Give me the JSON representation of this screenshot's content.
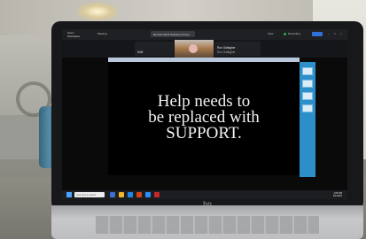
{
  "photo": {
    "setting": "room",
    "device": "laptop"
  },
  "laptop": {
    "brand_logo": "hp"
  },
  "zoom": {
    "app_title_line1": "Zoom",
    "app_title_line2": "Workplace",
    "top_item": "Meeting",
    "tab_label": "Remote Work Solutions Group",
    "view_label": "View",
    "participant_1": "Holli",
    "participant_2": "Ron Gallagher",
    "participant_2_sub": "Ron Gallagher",
    "recording_label": "Recording",
    "leave_label": "Leave"
  },
  "slide": {
    "line1": "Help needs to",
    "line2": "be replaced with",
    "line3": "SUPPORT."
  },
  "taskbar": {
    "search_placeholder": "Type here to search",
    "time": "1:05 PM",
    "date": "6/1/2022"
  },
  "icons": [
    "windows-icon",
    "search-icon",
    "video-icon",
    "mic-icon",
    "share-icon",
    "chat-icon",
    "participants-icon"
  ],
  "colors": {
    "slide_bg": "#000000",
    "slide_text": "#f2f2f2",
    "zoom_dark": "#1f2023",
    "side_panel": "#2d8fc9",
    "taskbar": "#1c1d21"
  }
}
